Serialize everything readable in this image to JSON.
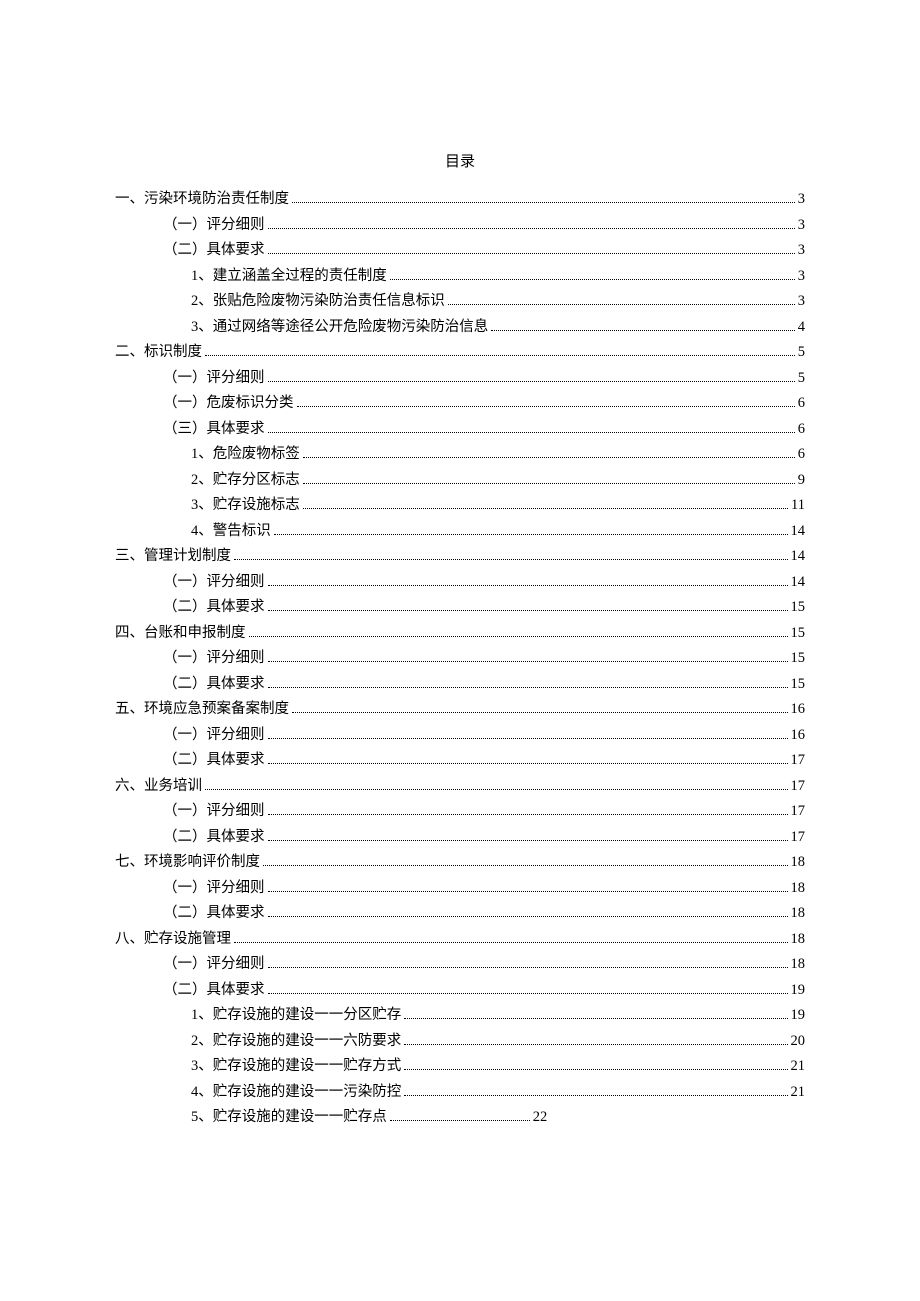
{
  "title": "目录",
  "entries": [
    {
      "indent": 0,
      "label": "一、污染环境防治责任制度",
      "page": "3"
    },
    {
      "indent": 1,
      "label": "（一）评分细则",
      "page": "3"
    },
    {
      "indent": 1,
      "label": "（二）具体要求",
      "page": "3"
    },
    {
      "indent": 2,
      "label": "1、建立涵盖全过程的责任制度",
      "page": "3"
    },
    {
      "indent": 2,
      "label": "2、张贴危险废物污染防治责任信息标识",
      "page": "3"
    },
    {
      "indent": 2,
      "label": "3、通过网络等途径公开危险废物污染防治信息",
      "page": "4"
    },
    {
      "indent": 0,
      "label": "二、标识制度",
      "page": "5"
    },
    {
      "indent": 1,
      "label": "（一）评分细则",
      "page": "5"
    },
    {
      "indent": 1,
      "label": "（一）危废标识分类",
      "page": "6"
    },
    {
      "indent": 1,
      "label": "（三）具体要求",
      "page": "6"
    },
    {
      "indent": 2,
      "label": "1、危险废物标签",
      "page": "6"
    },
    {
      "indent": 2,
      "label": "2、贮存分区标志",
      "page": "9"
    },
    {
      "indent": 2,
      "label": "3、贮存设施标志",
      "page": "11"
    },
    {
      "indent": 2,
      "label": "4、警告标识",
      "page": "14"
    },
    {
      "indent": 0,
      "label": "三、管理计划制度",
      "page": "14"
    },
    {
      "indent": 1,
      "label": "（一）评分细则",
      "page": "14"
    },
    {
      "indent": 1,
      "label": "（二）具体要求",
      "page": "15"
    },
    {
      "indent": 0,
      "label": "四、台账和申报制度",
      "page": "15"
    },
    {
      "indent": 1,
      "label": "（一）评分细则",
      "page": "15"
    },
    {
      "indent": 1,
      "label": "（二）具体要求",
      "page": "15"
    },
    {
      "indent": 0,
      "label": "五、环境应急预案备案制度",
      "page": "16"
    },
    {
      "indent": 1,
      "label": "（一）评分细则",
      "page": "16"
    },
    {
      "indent": 1,
      "label": "（二）具体要求",
      "page": "17"
    },
    {
      "indent": 0,
      "label": "六、业务培训",
      "page": "17"
    },
    {
      "indent": 1,
      "label": "（一）评分细则",
      "page": "17"
    },
    {
      "indent": 1,
      "label": "（二）具体要求",
      "page": "17"
    },
    {
      "indent": 0,
      "label": "七、环境影响评价制度",
      "page": "18"
    },
    {
      "indent": 1,
      "label": "（一）评分细则",
      "page": "18"
    },
    {
      "indent": 1,
      "label": "（二）具体要求",
      "page": "18"
    },
    {
      "indent": 0,
      "label": "八、贮存设施管理",
      "page": "18"
    },
    {
      "indent": 1,
      "label": "（一）评分细则",
      "page": "18"
    },
    {
      "indent": 1,
      "label": "（二）具体要求",
      "page": "19"
    },
    {
      "indent": 2,
      "label": "1、贮存设施的建设一一分区贮存",
      "page": "19"
    },
    {
      "indent": 2,
      "label": "2、贮存设施的建设一一六防要求",
      "page": "20"
    },
    {
      "indent": 2,
      "label": "3、贮存设施的建设一一贮存方式",
      "page": "21"
    },
    {
      "indent": 2,
      "label": "4、贮存设施的建设一一污染防控",
      "page": "21"
    },
    {
      "indent": 2,
      "label": "5、贮存设施的建设一一贮存点",
      "page": "22",
      "short": true
    }
  ]
}
